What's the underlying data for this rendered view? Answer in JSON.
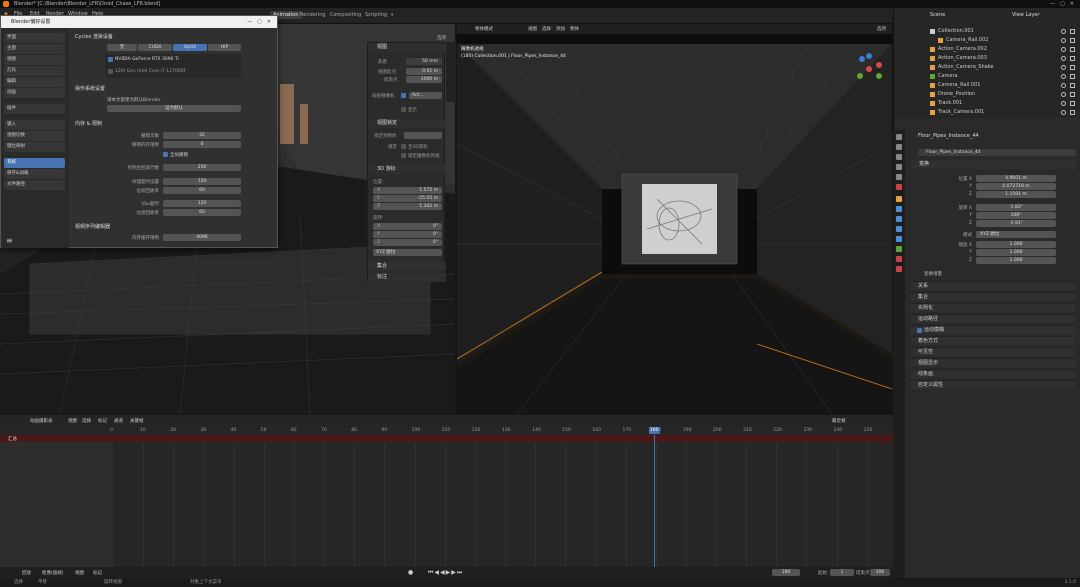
{
  "window": {
    "title": "Blender* [C:\\Blender\\Blender_LFR\\Droid_Chase_LFR.blend]"
  },
  "menu": [
    "File",
    "Edit",
    "Render",
    "Window",
    "Help"
  ],
  "workspaces": [
    "Layout",
    "Modeling",
    "Sculpting",
    "UV Editing",
    "Texture Paint",
    "Shading",
    "Animation",
    "Rendering",
    "Compositing",
    "Scripting",
    "+"
  ],
  "active_workspace": "Animation",
  "scene": {
    "label": "Scene",
    "view_layer": "View Layer"
  },
  "prefs": {
    "title": "Blender偏好设置",
    "nav": [
      "界面",
      "主题",
      "视图",
      "灯光",
      "编辑",
      "动画",
      "插件",
      "输入",
      "视图切换",
      "键位映射",
      "系统",
      "保存&加载",
      "文件路径"
    ],
    "nav_active": 10,
    "cycles_header": "Cycles 渲染设备",
    "device_tabs": [
      "无",
      "CUDA",
      "OptiX",
      "HIP"
    ],
    "device_active": 2,
    "gpu1": "NVIDIA GeForce RTX 3090 Ti",
    "gpu2": "12th Gen Intel Core i7-12700KF",
    "os_header": "操作系统设置",
    "os_text": "请本文部建为默认Blender",
    "os_btn": "设为默认",
    "mem_header": "内存 & 限制",
    "undo_steps_label": "撤销次数",
    "undo_steps": "32",
    "undo_mem_label": "撤销内存限制",
    "undo_mem": "0",
    "global_undo": "全局撤销",
    "console_label": "控制台回滚行数",
    "console_val": "256",
    "tex_label": "纹理超时设置",
    "tex_val": "120",
    "tex_gc_label": "垃圾回收率",
    "tex_gc_val": "60",
    "vbo_label": "Vbo超时",
    "vbo_val": "120",
    "vbo_gc_label": "垃圾回收率",
    "vbo_gc_val": "60",
    "seq_header": "视频序列编辑器",
    "seq_label": "内存缓存限制",
    "seq_val": "4096"
  },
  "npanel": {
    "view_header": "视图",
    "focal_label": "焦距",
    "focal_val": "50 mm",
    "clip_start_label": "视图起点",
    "clip_start_val": "0.01 m",
    "clip_end_label": "结束点",
    "clip_end_val": "1000 m",
    "lock_label": "局部摄像机",
    "lock_val": "Act...",
    "local_label": "显示",
    "view_lock_header": "视图锁定",
    "lock_obj_label": "锁定到物体",
    "lock_label2": "锁定",
    "lock_3d": "至3D游标",
    "lock_cam": "锁定摄像机到视",
    "cursor_header": "3D 游标",
    "location_label": "位置:",
    "cx": "1.572 m",
    "cy": "-25.55 m",
    "cz": "1.342 m",
    "rotation_label": "旋转:",
    "rx": "0°",
    "ry": "0°",
    "rz": "0°",
    "rot_mode": "XYZ 欧拉",
    "collections_header": "集合",
    "annotations_header": "标注"
  },
  "rightvp": {
    "mode": "物体模式",
    "menus": [
      "视图",
      "选择",
      "添加",
      "物体"
    ],
    "cam_label": "摄像机透视",
    "cam_sub": "(180) Collection.001 | Floor_Pipes_Instance_44",
    "options": "选项"
  },
  "outliner": {
    "rows": [
      "Collection.001",
      "Camera_Rail.002",
      "Action_Camera.002",
      "Action_Camera.003",
      "Action_Camera_Shake",
      "Camera",
      "Camera_Rail.001",
      "Drone_Position",
      "Track.001",
      "Track_Camera.001",
      "Camera_Rail",
      "Source001"
    ]
  },
  "properties": {
    "object_name": "Floor_Pipes_Instance_44",
    "object_name2": "Floor_Pipes_Instance_44",
    "transform_header": "变换",
    "loc_label": "位置 X",
    "loc_x": "4.9601 m",
    "loc_y": "0.072718 m",
    "loc_z": "1.1591 m",
    "rot_label": "旋转 X",
    "rot_x": "-1.83°",
    "rot_y": "108°",
    "rot_z": "-1.91°",
    "mode_label": "模式",
    "mode_val": "XYZ 欧拉",
    "scale_label": "缩放 X",
    "scale_x": "1.000",
    "scale_y": "1.000",
    "scale_z": "1.000",
    "delta": "变换增量",
    "sections": [
      "关系",
      "集合",
      "实例化",
      "运动路径",
      "运动模糊",
      "着色方式",
      "可见性",
      "视图显示",
      "线条画",
      "自定义属性"
    ]
  },
  "timeline": {
    "mode": "动画摄影表",
    "menus": [
      "视图",
      "选择",
      "标记",
      "通道",
      "关键帧"
    ],
    "summary": "汇总",
    "ticks": [
      "0",
      "10",
      "20",
      "30",
      "40",
      "50",
      "60",
      "70",
      "80",
      "90",
      "100",
      "110",
      "120",
      "130",
      "140",
      "150",
      "160",
      "170",
      "180",
      "190",
      "200",
      "210",
      "220",
      "230",
      "240",
      "250"
    ],
    "current_frame": "180",
    "filter": "最近帧",
    "start_label": "起始",
    "start": "1",
    "end_label": "结束点",
    "end": "300",
    "playback": "回放",
    "keying": "抠像(插帧)",
    "view": "视图",
    "markers": "标记"
  },
  "status": {
    "select": "选择",
    "pan": "平移",
    "rotate": "旋转视图",
    "context": "对象上下文菜单",
    "version": "3.1.0"
  }
}
